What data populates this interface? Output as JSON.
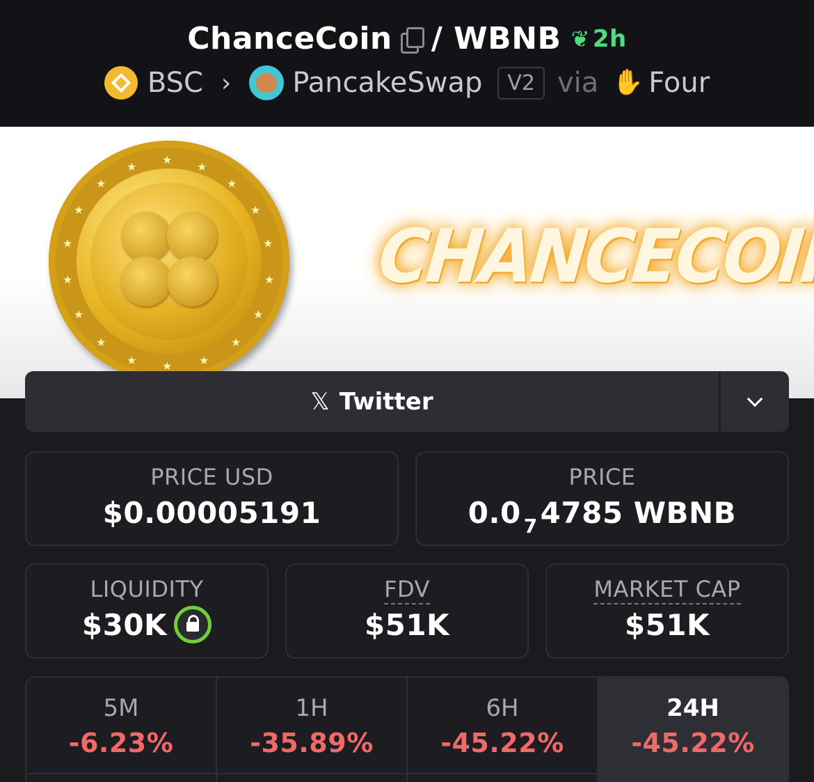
{
  "pair": {
    "base": "ChanceCoin",
    "quote": "/ WBNB",
    "age": "2h"
  },
  "route": {
    "chain": "BSC",
    "dex": "PancakeSwap",
    "version": "V2",
    "via": "via",
    "launchpad": "Four"
  },
  "banner": {
    "brand_text": "CHANCECOIN"
  },
  "social": {
    "twitter_label": "Twitter"
  },
  "price_usd": {
    "label": "PRICE USD",
    "value": "$0.00005191"
  },
  "price": {
    "label": "PRICE",
    "prefix": "0.0",
    "zeros_sub": "7",
    "digits": "4785 WBNB"
  },
  "liquidity": {
    "label": "LIQUIDITY",
    "value": "$30K"
  },
  "fdv": {
    "label": "FDV",
    "value": "$51K"
  },
  "market_cap": {
    "label": "MARKET CAP",
    "value": "$51K"
  },
  "timeframes": [
    {
      "label": "5M",
      "change": "-6.23%"
    },
    {
      "label": "1H",
      "change": "-35.89%"
    },
    {
      "label": "6H",
      "change": "-45.22%"
    },
    {
      "label": "24H",
      "change": "-45.22%"
    }
  ],
  "colors": {
    "header_bg": "#131317",
    "body_bg": "#1a1a1f",
    "positive_green": "#4ade80",
    "negative_red": "#f06969",
    "lock_ring": "#6fcf3a",
    "bsc_yellow": "#f3ba2f"
  },
  "icons": {
    "copy": "copy-icon",
    "age": "sprout-icon",
    "chain": "bsc-logo-icon",
    "dex": "pancakeswap-logo-icon",
    "launchpad": "four-hand-icon",
    "social": "x-logo-icon",
    "dropdown": "chevron-down-icon",
    "liquidity_lock": "lock-icon"
  }
}
